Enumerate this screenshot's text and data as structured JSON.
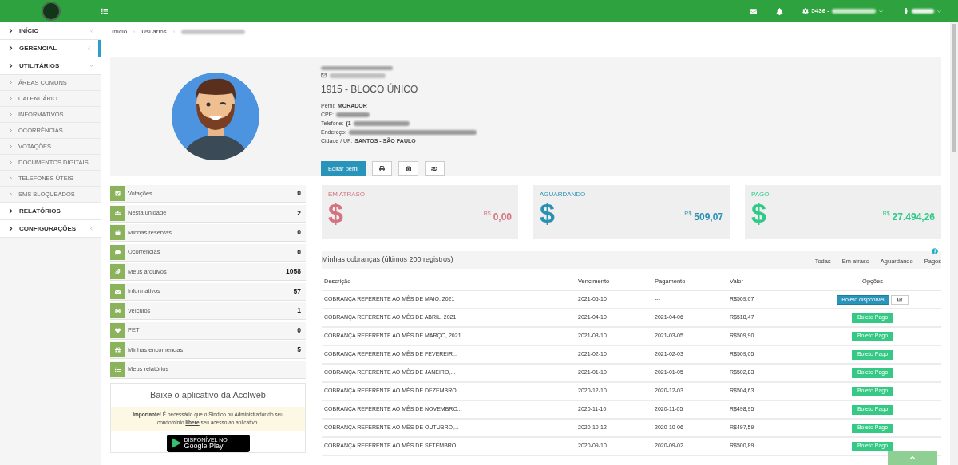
{
  "topbar": {
    "account": "5436 -"
  },
  "sidebar": {
    "items": [
      {
        "label": "INÍCIO",
        "expanded": false,
        "selected": false
      },
      {
        "label": "GERENCIAL",
        "expanded": false,
        "selected": true
      },
      {
        "label": "UTILITÁRIOS",
        "expanded": true,
        "selected": false,
        "children": [
          {
            "label": "ÁREAS COMUNS"
          },
          {
            "label": "CALENDÁRIO"
          },
          {
            "label": "INFORMATIVOS"
          },
          {
            "label": "OCORRÊNCIAS"
          },
          {
            "label": "VOTAÇÕES"
          },
          {
            "label": "DOCUMENTOS DIGITAIS"
          },
          {
            "label": "TELEFONES ÚTEIS"
          },
          {
            "label": "SMS BLOQUEADOS"
          }
        ]
      },
      {
        "label": "RELATÓRIOS",
        "selected": false
      },
      {
        "label": "CONFIGURAÇÕES",
        "expanded": false,
        "selected": false
      }
    ]
  },
  "breadcrumb": [
    "Início",
    "Usuários"
  ],
  "profile": {
    "unit": "1915 - BLOCO ÚNICO",
    "details": [
      {
        "label": "Perfil:",
        "value": "MORADOR"
      },
      {
        "label": "CPF:"
      },
      {
        "label": "Telefone:",
        "value": "(1"
      },
      {
        "label": "Endereço:"
      },
      {
        "label": "Cidade / UF:",
        "value": "SANTOS - SÃO PAULO"
      }
    ],
    "edit_button": "Editar perfil"
  },
  "stats": [
    {
      "label": "Votações",
      "count": "0"
    },
    {
      "label": "Nesta unidade",
      "count": "2"
    },
    {
      "label": "Minhas reservas",
      "count": "0"
    },
    {
      "label": "Ocorrências",
      "count": "0"
    },
    {
      "label": "Meus arquivos",
      "count": "1058"
    },
    {
      "label": "Informativos",
      "count": "57"
    },
    {
      "label": "Veículos",
      "count": "1"
    },
    {
      "label": "PET",
      "count": "0"
    },
    {
      "label": "Minhas encomendas",
      "count": "5"
    },
    {
      "label": "Meus relatórios"
    }
  ],
  "app_card": {
    "title": "Baixe o aplicativo da Acolweb",
    "notice_before": "**Importante!** É necessário que o Síndico ou Administrador do seu condomínio",
    "notice_link": "libere",
    "notice_after": "seu acesso ao aplicativo.",
    "store_small": "DISPONÍVEL NO",
    "store_big": "Google Play"
  },
  "summary": [
    {
      "label": "EM ATRASO",
      "symbol": "$",
      "currency": "R$",
      "amount": "0,00",
      "color": "#d4737f"
    },
    {
      "label": "AGUARDANDO",
      "symbol": "$",
      "currency": "R$",
      "amount": "509,07",
      "color": "#2b91b3"
    },
    {
      "label": "PAGO",
      "symbol": "$",
      "currency": "R$",
      "amount": "27.494,26",
      "color": "#2fca8a"
    }
  ],
  "charges": {
    "title": "Minhas cobranças (últimos 200 registros)",
    "filters": [
      "Todas",
      "Em atraso",
      "Aguardando",
      "Pagos"
    ],
    "columns": [
      "Descrição",
      "Vencimento",
      "Pagamento",
      "Valor",
      "Opções"
    ],
    "rows": [
      {
        "description": "COBRANÇA REFERENTE AO MÊS DE MAIO, 2021",
        "due": "2021-05-10",
        "paid": "---",
        "value": "R$509,07",
        "kind": "available",
        "action": "Boleto disponível"
      },
      {
        "description": "COBRANÇA REFERENTE AO MÊS DE ABRIL, 2021",
        "due": "2021-04-10",
        "paid": "2021-04-06",
        "value": "R$518,47",
        "kind": "paid",
        "action": "Boleto Pago"
      },
      {
        "description": "COBRANÇA REFERENTE AO MÊS DE MARÇO, 2021",
        "due": "2021-03-10",
        "paid": "2021-03-05",
        "value": "R$509,90",
        "kind": "paid",
        "action": "Boleto Pago"
      },
      {
        "description": "COBRANÇA REFERENTE AO MÊS DE FEVEREIR...",
        "due": "2021-02-10",
        "paid": "2021-02-03",
        "value": "R$509,05",
        "kind": "paid",
        "action": "Boleto Pago"
      },
      {
        "description": "COBRANÇA REFERENTE AO MÊS DE JANEIRO,...",
        "due": "2021-01-10",
        "paid": "2021-01-05",
        "value": "R$502,83",
        "kind": "paid",
        "action": "Boleto Pago"
      },
      {
        "description": "COBRANÇA REFERENTE AO MÊS DE DEZEMBRO...",
        "due": "2020-12-10",
        "paid": "2020-12-03",
        "value": "R$504,63",
        "kind": "paid",
        "action": "Boleto Pago"
      },
      {
        "description": "COBRANÇA REFERENTE AO MÊS DE NOVEMBRO...",
        "due": "2020-11-10",
        "paid": "2020-11-05",
        "value": "R$498,95",
        "kind": "paid",
        "action": "Boleto Pago"
      },
      {
        "description": "COBRANÇA REFERENTE AO MÊS DE OUTUBRO,...",
        "due": "2020-10-12",
        "paid": "2020-10-06",
        "value": "R$497,59",
        "kind": "paid",
        "action": "Boleto Pago"
      },
      {
        "description": "COBRANÇA REFERENTE AO MÊS DE SETEMBRO...",
        "due": "2020-09-10",
        "paid": "2020-09-02",
        "value": "R$500,89",
        "kind": "paid",
        "action": "Boleto Pago"
      }
    ]
  }
}
